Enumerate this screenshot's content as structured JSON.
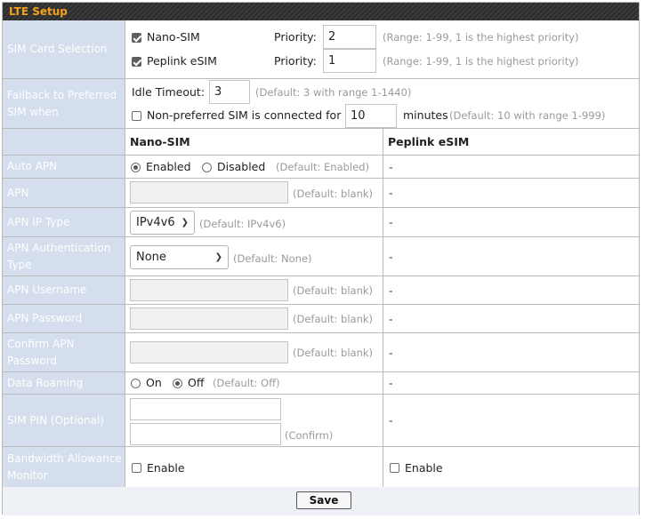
{
  "title": "LTE Setup",
  "sim_selection": {
    "label": "SIM Card Selection",
    "nano": {
      "name": "Nano-SIM",
      "checked": true,
      "priority_label": "Priority:",
      "priority": "2",
      "range": "(Range: 1-99, 1 is the highest priority)"
    },
    "peplink": {
      "name": "Peplink eSIM",
      "checked": true,
      "priority_label": "Priority:",
      "priority": "1",
      "range": "(Range: 1-99, 1 is the highest priority)"
    }
  },
  "failback": {
    "label": "Failback to Preferred SIM when",
    "idle_label": "Idle Timeout:",
    "idle_value": "3",
    "idle_hint": "(Default: 3 with range 1-1440)",
    "nonpref_label": "Non-preferred SIM is connected for",
    "nonpref_value": "10",
    "minutes": "minutes",
    "nonpref_hint": "(Default: 10 with range 1-999)"
  },
  "columns": {
    "nano": "Nano-SIM",
    "peplink": "Peplink eSIM"
  },
  "dash": "-",
  "auto_apn": {
    "label": "Auto APN",
    "enabled": "Enabled",
    "disabled": "Disabled",
    "hint": "(Default: Enabled)",
    "selected": "Enabled"
  },
  "apn": {
    "label": "APN",
    "value": "",
    "hint": "(Default: blank)"
  },
  "apn_ip_type": {
    "label": "APN IP Type",
    "value": "IPv4v6",
    "hint": "(Default: IPv4v6)"
  },
  "apn_auth": {
    "label": "APN Authentication Type",
    "value": "None",
    "hint": "(Default: None)"
  },
  "apn_username": {
    "label": "APN Username",
    "value": "",
    "hint": "(Default: blank)"
  },
  "apn_password": {
    "label": "APN Password",
    "value": "",
    "hint": "(Default: blank)"
  },
  "confirm_apn_password": {
    "label": "Confirm APN Password",
    "value": "",
    "hint": "(Default: blank)"
  },
  "data_roaming": {
    "label": "Data Roaming",
    "on": "On",
    "off": "Off",
    "hint": "(Default: Off)",
    "selected": "Off"
  },
  "sim_pin": {
    "label": "SIM PIN (Optional)",
    "value": "",
    "confirm_value": "",
    "confirm_hint": "(Confirm)"
  },
  "bandwidth": {
    "label": "Bandwidth Allowance Monitor",
    "enable": "Enable",
    "nano_checked": false,
    "peplink_checked": false
  },
  "save_label": "Save"
}
